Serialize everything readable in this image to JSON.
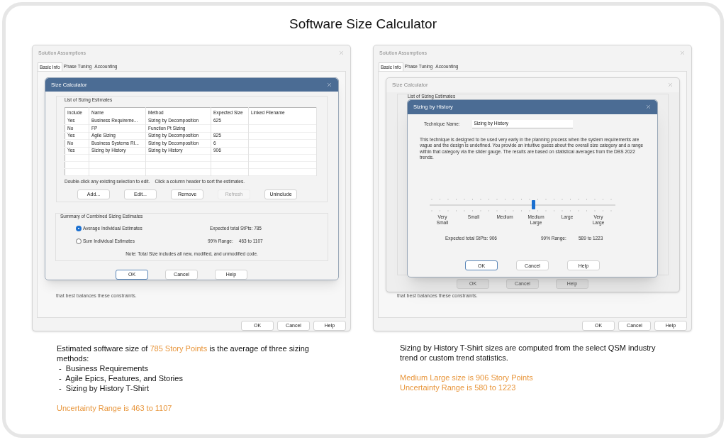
{
  "title": "Software Size Calculator",
  "left": {
    "window": {
      "title": "Solution Assumptions",
      "tabs": [
        {
          "label": "Basic Info",
          "selected": true
        },
        {
          "label": "Phase Tuning",
          "selected": false
        },
        {
          "label": "Accounting",
          "selected": false
        }
      ],
      "page_text": "that best balances these constraints.",
      "buttons": [
        "OK",
        "Cancel",
        "Help"
      ]
    },
    "dialog": {
      "title": "Size Calculator",
      "group_label": "List of Sizing Estimates",
      "columns": [
        "Include",
        "Name",
        "Method",
        "Expected Size",
        "Linked Filename"
      ],
      "rows": [
        [
          "Yes",
          "Business Requireme...",
          "Sizing by Decomposition",
          "625",
          ""
        ],
        [
          "No",
          "FP",
          "Function Pt Sizing",
          "",
          ""
        ],
        [
          "Yes",
          "Agile Sizing",
          "Sizing by Decomposition",
          "825",
          ""
        ],
        [
          "No",
          "Business Systems RI...",
          "Sizing by Decomposition",
          "6",
          ""
        ],
        [
          "Yes",
          "Sizing by History",
          "Sizing by History",
          "906",
          ""
        ]
      ],
      "hint": "Double-click any existing selection to edit.    Click a column header to sort the estimates.",
      "list_buttons": [
        {
          "label": "Add...",
          "disabled": false
        },
        {
          "label": "Edit...",
          "disabled": false
        },
        {
          "label": "Remove",
          "disabled": false
        },
        {
          "label": "Refresh",
          "disabled": true
        },
        {
          "label": "Uninclude",
          "disabled": false
        }
      ],
      "summary": {
        "label": "Summary of Combined Sizing Estimates",
        "options": [
          {
            "label": "Average Individual Estimates",
            "selected": true
          },
          {
            "label": "Sum Individual Estimates",
            "selected": false
          }
        ],
        "expected": "Expected total StPts: 785",
        "range_label": "99% Range:",
        "range": "463 to 1107",
        "note": "Note:  Total Size includes all new, modified, and unmodified code."
      },
      "buttons": [
        "OK",
        "Cancel",
        "Help"
      ]
    },
    "caption": {
      "before": "Estimated software size of ",
      "highlight": "785 Story Points",
      "after": " is the average of three sizing methods:",
      "items": [
        " -  Business Requirements",
        " -  Agile Epics, Features, and Stories",
        " -  Sizing by History T-Shirt"
      ],
      "notes": [
        "Uncertainty Range is 463 to 1107"
      ]
    }
  },
  "right": {
    "window": {
      "title": "Solution Assumptions",
      "tabs": [
        {
          "label": "Basic Info",
          "selected": true
        },
        {
          "label": "Phase Tuning",
          "selected": false
        },
        {
          "label": "Accounting",
          "selected": false
        }
      ],
      "page_text": "that best balances these constraints.",
      "buttons": [
        "OK",
        "Cancel",
        "Help"
      ]
    },
    "background_dialog": {
      "title": "Size Calculator",
      "group_label": "List of Sizing Estimates",
      "buttons": [
        "OK",
        "Cancel",
        "Help"
      ]
    },
    "dialog": {
      "title": "Sizing by History",
      "technique_label": "Technique Name:",
      "technique_value": "Sizing by History",
      "description": "This technique is designed to be used very early in the planning process when the system requirements are vague and the design is undefined.  You provide an intuitive guess about the overall size category and a range within that category via the slider gauge.  The results are based on statistical averages from the DBS 2022 trends.",
      "slider": {
        "level": 0.56,
        "labels": [
          "Very\nSmall",
          "Small",
          "Medium",
          "Medium\nLarge",
          "Large",
          "Very\nLarge"
        ]
      },
      "expected": "Expected total StPts: 906",
      "range_label": "99% Range:",
      "range": "589 to 1223",
      "buttons": [
        "OK",
        "Cancel",
        "Help"
      ]
    },
    "caption": {
      "text": "Sizing by History T-Shirt sizes are computed from the select QSM industry trend or custom trend statistics.",
      "notes": [
        "Medium Large size is 906 Story Points",
        "Uncertainty Range is 580 to 1223"
      ]
    }
  }
}
